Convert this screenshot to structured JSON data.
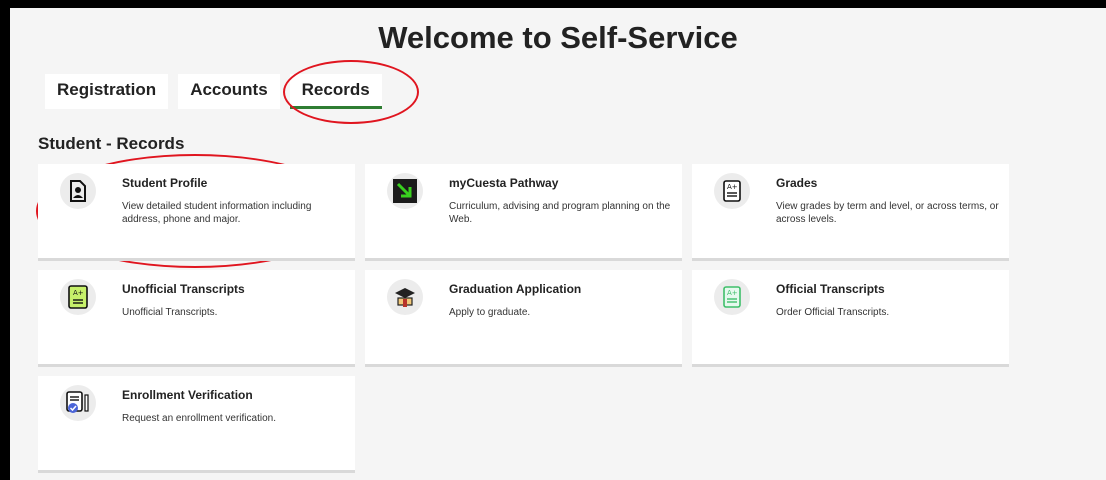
{
  "page": {
    "title": "Welcome to Self-Service"
  },
  "tabs": [
    {
      "label": "Registration",
      "active": false
    },
    {
      "label": "Accounts",
      "active": false
    },
    {
      "label": "Records",
      "active": true
    }
  ],
  "section": {
    "title": "Student - Records"
  },
  "cards": [
    {
      "title": "Student Profile",
      "description": "View detailed student information including address, phone and major.",
      "icon": "student-profile-icon"
    },
    {
      "title": "myCuesta Pathway",
      "description": "Curriculum, advising and program planning on the Web.",
      "icon": "pathway-arrow-icon"
    },
    {
      "title": "Grades",
      "description": "View grades by term and level, or across terms, or across levels.",
      "icon": "grades-icon"
    },
    {
      "title": "Unofficial Transcripts",
      "description": "Unofficial Transcripts.",
      "icon": "unofficial-transcript-icon"
    },
    {
      "title": "Graduation Application",
      "description": "Apply to graduate.",
      "icon": "graduation-cap-icon"
    },
    {
      "title": "Official Transcripts",
      "description": "Order Official Transcripts.",
      "icon": "official-transcript-icon"
    },
    {
      "title": "Enrollment Verification",
      "description": "Request an enrollment verification.",
      "icon": "enrollment-verification-icon"
    }
  ],
  "colors": {
    "accent": "#2e7d32",
    "annotation": "#e0151f",
    "pathway_green": "#39d01f"
  }
}
